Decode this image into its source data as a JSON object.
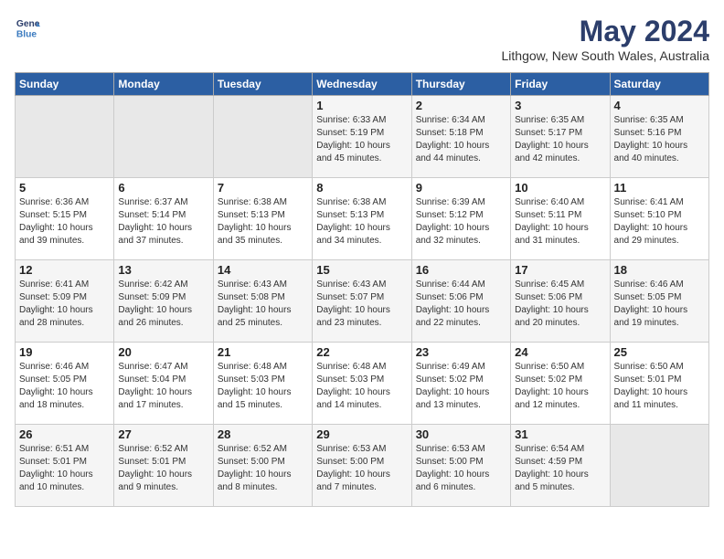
{
  "header": {
    "logo_line1": "General",
    "logo_line2": "Blue",
    "month_title": "May 2024",
    "location": "Lithgow, New South Wales, Australia"
  },
  "weekdays": [
    "Sunday",
    "Monday",
    "Tuesday",
    "Wednesday",
    "Thursday",
    "Friday",
    "Saturday"
  ],
  "weeks": [
    [
      {
        "day": "",
        "sunrise": "",
        "sunset": "",
        "daylight": ""
      },
      {
        "day": "",
        "sunrise": "",
        "sunset": "",
        "daylight": ""
      },
      {
        "day": "",
        "sunrise": "",
        "sunset": "",
        "daylight": ""
      },
      {
        "day": "1",
        "sunrise": "Sunrise: 6:33 AM",
        "sunset": "Sunset: 5:19 PM",
        "daylight": "Daylight: 10 hours and 45 minutes."
      },
      {
        "day": "2",
        "sunrise": "Sunrise: 6:34 AM",
        "sunset": "Sunset: 5:18 PM",
        "daylight": "Daylight: 10 hours and 44 minutes."
      },
      {
        "day": "3",
        "sunrise": "Sunrise: 6:35 AM",
        "sunset": "Sunset: 5:17 PM",
        "daylight": "Daylight: 10 hours and 42 minutes."
      },
      {
        "day": "4",
        "sunrise": "Sunrise: 6:35 AM",
        "sunset": "Sunset: 5:16 PM",
        "daylight": "Daylight: 10 hours and 40 minutes."
      }
    ],
    [
      {
        "day": "5",
        "sunrise": "Sunrise: 6:36 AM",
        "sunset": "Sunset: 5:15 PM",
        "daylight": "Daylight: 10 hours and 39 minutes."
      },
      {
        "day": "6",
        "sunrise": "Sunrise: 6:37 AM",
        "sunset": "Sunset: 5:14 PM",
        "daylight": "Daylight: 10 hours and 37 minutes."
      },
      {
        "day": "7",
        "sunrise": "Sunrise: 6:38 AM",
        "sunset": "Sunset: 5:13 PM",
        "daylight": "Daylight: 10 hours and 35 minutes."
      },
      {
        "day": "8",
        "sunrise": "Sunrise: 6:38 AM",
        "sunset": "Sunset: 5:13 PM",
        "daylight": "Daylight: 10 hours and 34 minutes."
      },
      {
        "day": "9",
        "sunrise": "Sunrise: 6:39 AM",
        "sunset": "Sunset: 5:12 PM",
        "daylight": "Daylight: 10 hours and 32 minutes."
      },
      {
        "day": "10",
        "sunrise": "Sunrise: 6:40 AM",
        "sunset": "Sunset: 5:11 PM",
        "daylight": "Daylight: 10 hours and 31 minutes."
      },
      {
        "day": "11",
        "sunrise": "Sunrise: 6:41 AM",
        "sunset": "Sunset: 5:10 PM",
        "daylight": "Daylight: 10 hours and 29 minutes."
      }
    ],
    [
      {
        "day": "12",
        "sunrise": "Sunrise: 6:41 AM",
        "sunset": "Sunset: 5:09 PM",
        "daylight": "Daylight: 10 hours and 28 minutes."
      },
      {
        "day": "13",
        "sunrise": "Sunrise: 6:42 AM",
        "sunset": "Sunset: 5:09 PM",
        "daylight": "Daylight: 10 hours and 26 minutes."
      },
      {
        "day": "14",
        "sunrise": "Sunrise: 6:43 AM",
        "sunset": "Sunset: 5:08 PM",
        "daylight": "Daylight: 10 hours and 25 minutes."
      },
      {
        "day": "15",
        "sunrise": "Sunrise: 6:43 AM",
        "sunset": "Sunset: 5:07 PM",
        "daylight": "Daylight: 10 hours and 23 minutes."
      },
      {
        "day": "16",
        "sunrise": "Sunrise: 6:44 AM",
        "sunset": "Sunset: 5:06 PM",
        "daylight": "Daylight: 10 hours and 22 minutes."
      },
      {
        "day": "17",
        "sunrise": "Sunrise: 6:45 AM",
        "sunset": "Sunset: 5:06 PM",
        "daylight": "Daylight: 10 hours and 20 minutes."
      },
      {
        "day": "18",
        "sunrise": "Sunrise: 6:46 AM",
        "sunset": "Sunset: 5:05 PM",
        "daylight": "Daylight: 10 hours and 19 minutes."
      }
    ],
    [
      {
        "day": "19",
        "sunrise": "Sunrise: 6:46 AM",
        "sunset": "Sunset: 5:05 PM",
        "daylight": "Daylight: 10 hours and 18 minutes."
      },
      {
        "day": "20",
        "sunrise": "Sunrise: 6:47 AM",
        "sunset": "Sunset: 5:04 PM",
        "daylight": "Daylight: 10 hours and 17 minutes."
      },
      {
        "day": "21",
        "sunrise": "Sunrise: 6:48 AM",
        "sunset": "Sunset: 5:03 PM",
        "daylight": "Daylight: 10 hours and 15 minutes."
      },
      {
        "day": "22",
        "sunrise": "Sunrise: 6:48 AM",
        "sunset": "Sunset: 5:03 PM",
        "daylight": "Daylight: 10 hours and 14 minutes."
      },
      {
        "day": "23",
        "sunrise": "Sunrise: 6:49 AM",
        "sunset": "Sunset: 5:02 PM",
        "daylight": "Daylight: 10 hours and 13 minutes."
      },
      {
        "day": "24",
        "sunrise": "Sunrise: 6:50 AM",
        "sunset": "Sunset: 5:02 PM",
        "daylight": "Daylight: 10 hours and 12 minutes."
      },
      {
        "day": "25",
        "sunrise": "Sunrise: 6:50 AM",
        "sunset": "Sunset: 5:01 PM",
        "daylight": "Daylight: 10 hours and 11 minutes."
      }
    ],
    [
      {
        "day": "26",
        "sunrise": "Sunrise: 6:51 AM",
        "sunset": "Sunset: 5:01 PM",
        "daylight": "Daylight: 10 hours and 10 minutes."
      },
      {
        "day": "27",
        "sunrise": "Sunrise: 6:52 AM",
        "sunset": "Sunset: 5:01 PM",
        "daylight": "Daylight: 10 hours and 9 minutes."
      },
      {
        "day": "28",
        "sunrise": "Sunrise: 6:52 AM",
        "sunset": "Sunset: 5:00 PM",
        "daylight": "Daylight: 10 hours and 8 minutes."
      },
      {
        "day": "29",
        "sunrise": "Sunrise: 6:53 AM",
        "sunset": "Sunset: 5:00 PM",
        "daylight": "Daylight: 10 hours and 7 minutes."
      },
      {
        "day": "30",
        "sunrise": "Sunrise: 6:53 AM",
        "sunset": "Sunset: 5:00 PM",
        "daylight": "Daylight: 10 hours and 6 minutes."
      },
      {
        "day": "31",
        "sunrise": "Sunrise: 6:54 AM",
        "sunset": "Sunset: 4:59 PM",
        "daylight": "Daylight: 10 hours and 5 minutes."
      },
      {
        "day": "",
        "sunrise": "",
        "sunset": "",
        "daylight": ""
      }
    ]
  ]
}
